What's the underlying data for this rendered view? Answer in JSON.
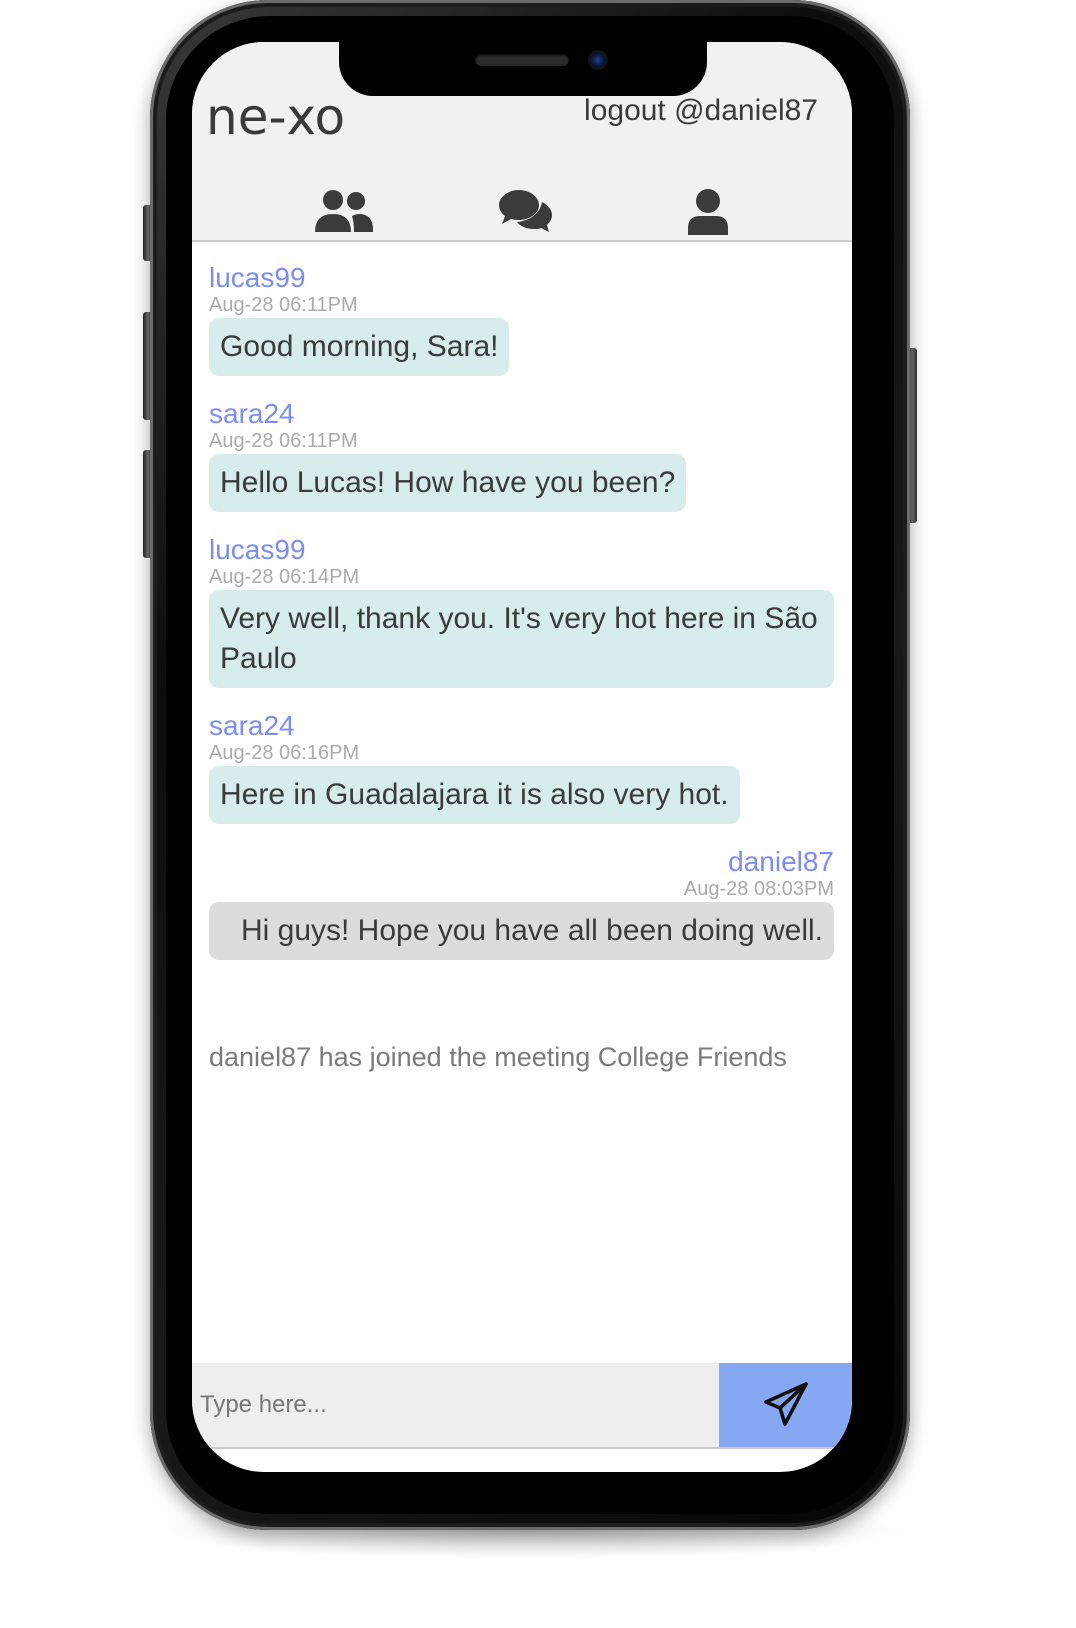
{
  "header": {
    "logo": "ne-xo",
    "logout_label": "logout @daniel87"
  },
  "nav": {
    "icons": [
      "users-icon",
      "chat-bubbles-icon",
      "profile-icon"
    ]
  },
  "messages": [
    {
      "author": "lucas99",
      "time": "Aug-28 06:11PM",
      "text": "Good morning, Sara!"
    },
    {
      "author": "sara24",
      "time": "Aug-28 06:11PM",
      "text": "Hello Lucas! How have you been?"
    },
    {
      "author": "lucas99",
      "time": "Aug-28 06:14PM",
      "text": "Very well, thank you. It's very hot here in São Paulo"
    },
    {
      "author": "sara24",
      "time": "Aug-28 06:16PM",
      "text": "Here in Guadalajara it is also very hot."
    },
    {
      "author": "daniel87",
      "time": "Aug-28 08:03PM",
      "text": "Hi guys! Hope you have all been doing well."
    }
  ],
  "system_note": "daniel87 has joined the meeting College Friends",
  "composer": {
    "placeholder": "Type here...",
    "value": "",
    "send_icon": "paper-plane-icon"
  },
  "colors": {
    "author": "#7b8cf5",
    "bubble_other": "#d7ecec",
    "bubble_mine": "#dcdcdc",
    "send_button": "#86a8f3"
  }
}
